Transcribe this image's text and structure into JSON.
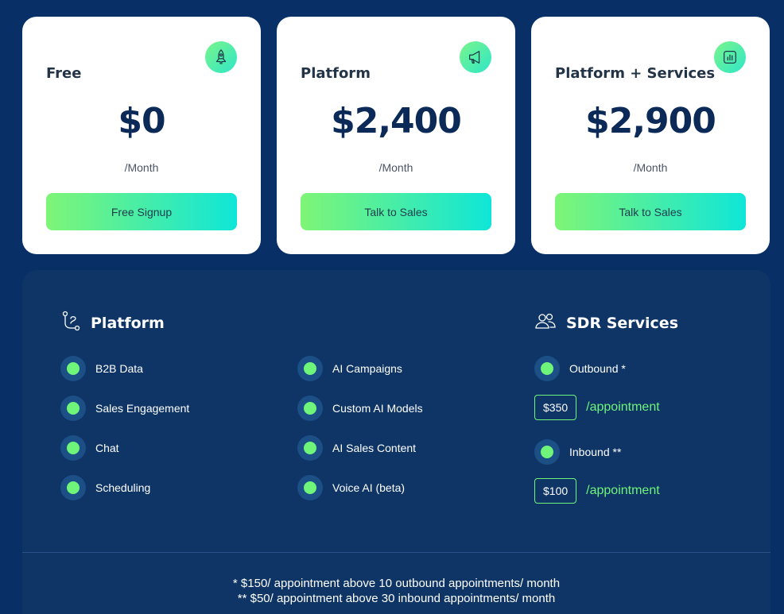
{
  "plans": [
    {
      "title": "Free",
      "icon": "rocket-icon",
      "price": "$0",
      "period": "/Month",
      "cta": "Free Signup"
    },
    {
      "title": "Platform",
      "icon": "megaphone-icon",
      "price": "$2,400",
      "period": "/Month",
      "cta": "Talk to Sales"
    },
    {
      "title": "Platform + Services",
      "icon": "chart-icon",
      "price": "$2,900",
      "period": "/Month",
      "cta": "Talk to Sales"
    }
  ],
  "platform": {
    "heading": "Platform",
    "icon": "route-icon",
    "features_col1": [
      "B2B Data",
      "Sales Engagement",
      "Chat",
      "Scheduling"
    ],
    "features_col2": [
      "AI Campaigns",
      "Custom AI Models",
      "AI Sales Content",
      "Voice AI (beta)"
    ]
  },
  "sdr": {
    "heading": "SDR Services",
    "icon": "users-icon",
    "outbound": {
      "label": "Outbound *",
      "price": "$350",
      "unit": "/appointment"
    },
    "inbound": {
      "label": "Inbound **",
      "price": "$100",
      "unit": "/appointment"
    }
  },
  "footnotes": [
    "* $150/ appointment above 10 outbound appointments/ month",
    "** $50/ appointment above 30 inbound appointments/ month"
  ],
  "colors": {
    "background": "#082f66",
    "panel": "#0e3565",
    "accent": "#6ef57a",
    "price": "#0b2a57"
  }
}
